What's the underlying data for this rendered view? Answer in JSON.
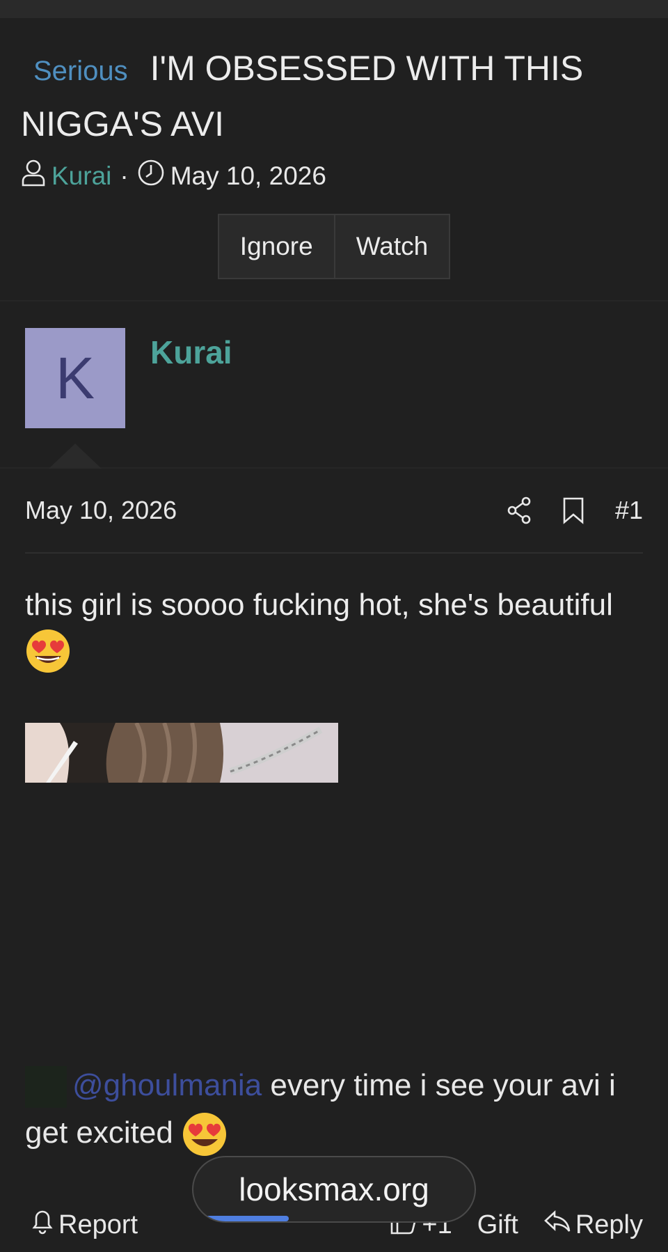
{
  "thread": {
    "prefix": "Serious",
    "title": "I'M OBSESSED WITH THIS NIGGA'S AVI",
    "author": "Kurai",
    "separator": "·",
    "date": "May 10, 2026",
    "buttons": {
      "ignore": "Ignore",
      "watch": "Watch"
    }
  },
  "post": {
    "avatar_letter": "K",
    "username": "Kurai",
    "date": "May 10, 2026",
    "number": "#1",
    "text": "this girl is soooo fucking hot, she's beautiful",
    "reply_mention": "@ghoulmania",
    "reply_text_1": " every time i see your avi i",
    "reply_text_2": "get excited"
  },
  "footer": {
    "report": "Report",
    "like_count": "+1",
    "gift": "Gift",
    "reply": "Reply"
  },
  "overlay": {
    "site": "looksmax.org",
    "progress": 0.34
  },
  "colors": {
    "accent_teal": "#4da39a",
    "prefix_blue": "#4f8fc0",
    "mention_blue": "#3d4e9c",
    "avatar_bg": "#9b9ac8",
    "progress_blue": "#4f7ee0"
  },
  "icons": [
    "user-icon",
    "clock-icon",
    "share-icon",
    "bookmark-icon",
    "bell-icon",
    "thumbs-up-icon",
    "reply-icon",
    "heart-eyes-emoji"
  ]
}
